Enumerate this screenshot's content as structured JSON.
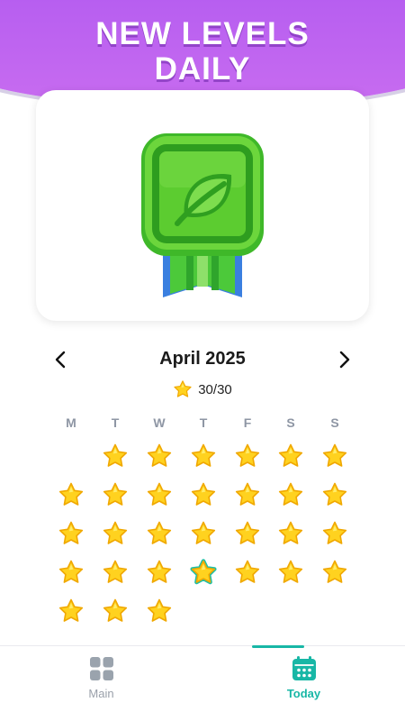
{
  "banner": {
    "line1": "NEW LEVELS",
    "line2": "DAILY"
  },
  "badge": {
    "icon": "leaf-icon",
    "color": "#5fcf2c"
  },
  "calendar": {
    "month": "April 2025",
    "prev_icon": "chevron-left-icon",
    "next_icon": "chevron-right-icon",
    "score": "30/30",
    "weekdays": [
      "M",
      "T",
      "W",
      "T",
      "F",
      "S",
      "S"
    ],
    "first_weekday_index": 1,
    "days_in_month": 30,
    "completed_days": 30,
    "today": 24
  },
  "nav": {
    "main_label": "Main",
    "today_label": "Today",
    "active": "Today",
    "accent": "#18b7a6"
  }
}
